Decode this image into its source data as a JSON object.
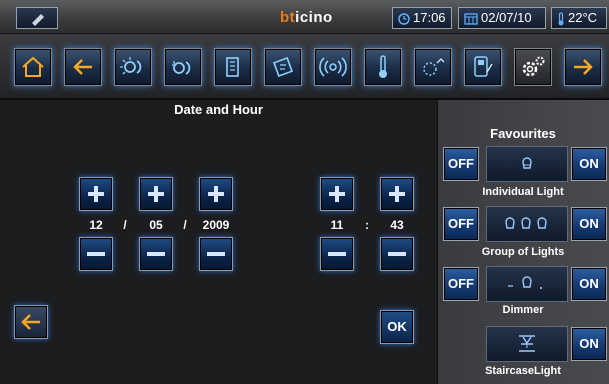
{
  "topbar": {
    "brand_prefix": "bt",
    "brand_suffix": "icino",
    "time": "17:06",
    "date": "02/07/10",
    "temperature": "22°C"
  },
  "nav": {
    "items": [
      {
        "name": "home-icon"
      },
      {
        "name": "back-arrow-icon"
      },
      {
        "name": "lighting-icon"
      },
      {
        "name": "lighting-group-icon"
      },
      {
        "name": "scenarios-icon"
      },
      {
        "name": "automation-icon"
      },
      {
        "name": "audio-icon"
      },
      {
        "name": "thermometer-icon"
      },
      {
        "name": "energy-icon"
      },
      {
        "name": "intercom-icon"
      },
      {
        "name": "settings-gear-icon"
      },
      {
        "name": "forward-arrow-icon"
      }
    ]
  },
  "main": {
    "title": "Date and Hour",
    "day": "12",
    "month": "05",
    "year": "2009",
    "date_sep": "/",
    "hour": "11",
    "minute": "43",
    "time_sep": ":",
    "ok_label": "OK"
  },
  "favourites": {
    "title": "Favourites",
    "off_label": "OFF",
    "on_label": "ON",
    "items": [
      {
        "label": "Individual Light"
      },
      {
        "label": "Group of Lights"
      },
      {
        "label": "Dimmer"
      },
      {
        "label": "StaircaseLight"
      }
    ]
  },
  "colors": {
    "accent_orange": "#f5a623",
    "button_blue": "#1f4c86"
  }
}
